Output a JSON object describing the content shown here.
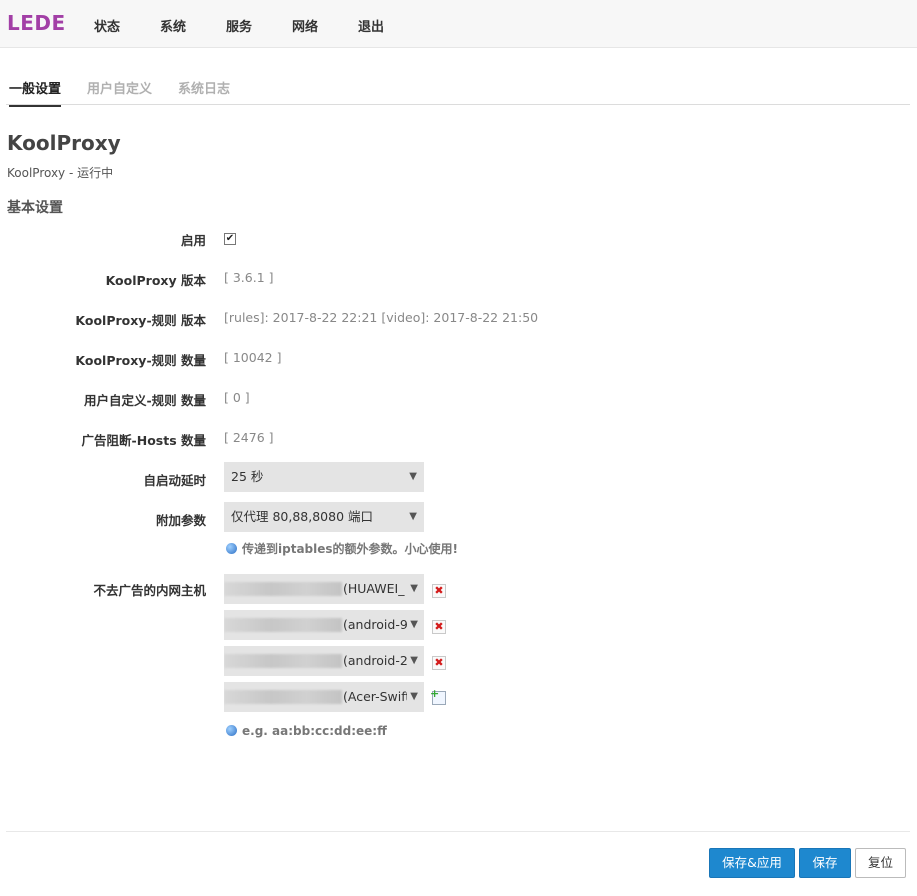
{
  "brand": "LEDE",
  "nav": [
    "状态",
    "系统",
    "服务",
    "网络",
    "退出"
  ],
  "tabs": [
    "一般设置",
    "用户自定义",
    "系统日志"
  ],
  "active_tab": "一般设置",
  "page": {
    "title": "KoolProxy",
    "status": "KoolProxy - 运行中",
    "section_title": "基本设置"
  },
  "fields": {
    "enable_label": "启用",
    "enable_checked": true,
    "enable_mark": "✔",
    "version_label": "KoolProxy 版本",
    "version_value": "[ 3.6.1 ]",
    "rules_version_label": "KoolProxy-规则 版本",
    "rules_version_value": "[rules]: 2017-8-22 22:21 [video]: 2017-8-22 21:50",
    "rules_count_label": "KoolProxy-规则 数量",
    "rules_count_value": "[ 10042 ]",
    "user_rules_count_label": "用户自定义-规则 数量",
    "user_rules_count_value": "[ 0 ]",
    "hosts_count_label": "广告阻断-Hosts 数量",
    "hosts_count_value": "[ 2476 ]",
    "startup_delay_label": "自启动延时",
    "startup_delay_value": "25 秒",
    "extra_args_label": "附加参数",
    "extra_args_value": "仅代理 80,88,8080 端口",
    "extra_args_hint": "传递到iptables的额外参数。小心使用!",
    "hosts_label": "不去广告的内网主机",
    "hosts": [
      "(HUAWEI_",
      "(android-9",
      "(android-2",
      "(Acer-Swift"
    ],
    "hosts_hint": "e.g. aa:bb:cc:dd:ee:ff"
  },
  "buttons": {
    "save_apply": "保存&应用",
    "save": "保存",
    "reset": "复位"
  },
  "icons": {
    "select_caret": "▼",
    "remove": "✖",
    "add": "+"
  },
  "colors": {
    "brand": "#a23fa6",
    "primary": "#1e88cf"
  }
}
